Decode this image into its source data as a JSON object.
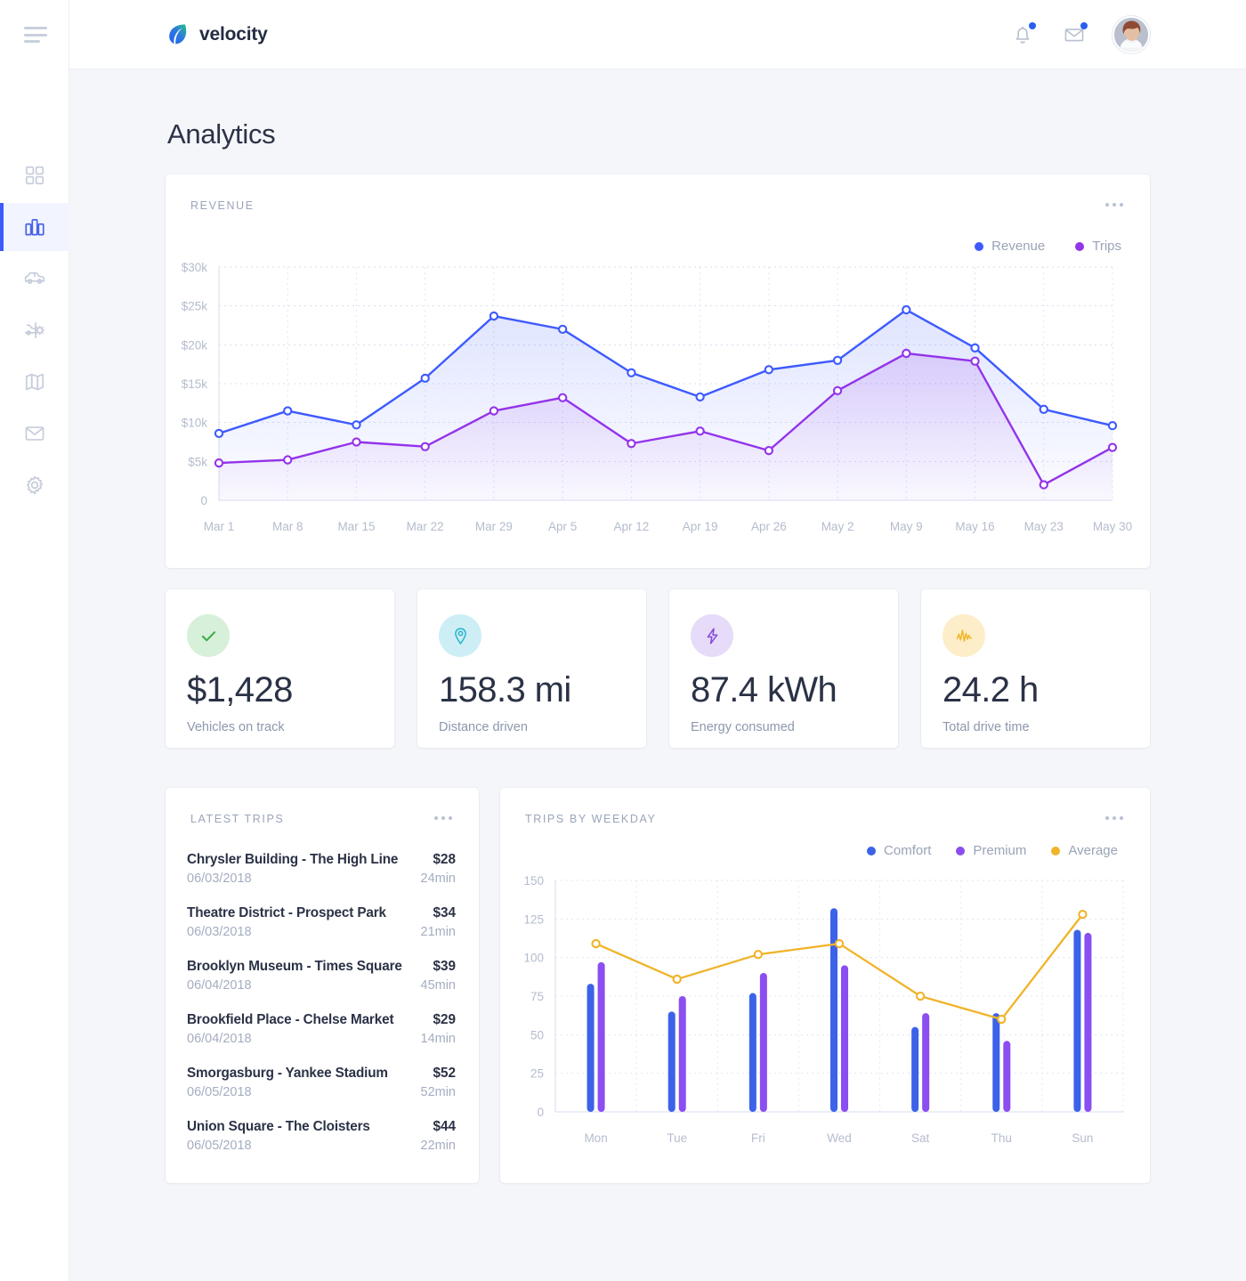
{
  "brand": {
    "name": "velocity",
    "logo_icon": "leaf-logo-icon"
  },
  "sidebar": {
    "menu_icon": "hamburger-menu-icon",
    "items": [
      {
        "name": "dashboard",
        "icon": "grid-icon",
        "active": false
      },
      {
        "name": "analytics",
        "icon": "bar-chart-icon",
        "active": true
      },
      {
        "name": "vehicles",
        "icon": "car-icon",
        "active": false
      },
      {
        "name": "maintenance",
        "icon": "car-settings-icon",
        "active": false
      },
      {
        "name": "map",
        "icon": "map-icon",
        "active": false
      },
      {
        "name": "messages",
        "icon": "mail-icon",
        "active": false
      },
      {
        "name": "settings",
        "icon": "gear-icon",
        "active": false
      }
    ]
  },
  "topbar": {
    "notifications_icon": "bell-icon",
    "messages_icon": "envelope-icon",
    "avatar": "user-avatar",
    "has_notification_badge": true,
    "has_message_badge": true
  },
  "page": {
    "title": "Analytics"
  },
  "revenue_card": {
    "label": "Revenue",
    "menu": "more-options"
  },
  "stats": [
    {
      "value": "$1,428",
      "caption": "Vehicles on track",
      "icon": "check-icon",
      "icon_bg": "#d7f0d9",
      "icon_color": "#3faa50"
    },
    {
      "value": "158.3 mi",
      "caption": "Distance driven",
      "icon": "map-pin-icon",
      "icon_bg": "#cdeef5",
      "icon_color": "#28b3cc"
    },
    {
      "value": "87.4 kWh",
      "caption": "Energy consumed",
      "icon": "lightning-bolt-icon",
      "icon_bg": "#e6dbf8",
      "icon_color": "#8249d6"
    },
    {
      "value": "24.2 h",
      "caption": "Total drive time",
      "icon": "activity-pulse-icon",
      "icon_bg": "#fdeec9",
      "icon_color": "#f1b52a"
    }
  ],
  "trips_card": {
    "label": "Latest trips",
    "menu": "more-options",
    "items": [
      {
        "name": "Chrysler Building - The High Line",
        "price": "$28",
        "date": "06/03/2018",
        "duration": "24min"
      },
      {
        "name": "Theatre District - Prospect Park",
        "price": "$34",
        "date": "06/03/2018",
        "duration": "21min"
      },
      {
        "name": "Brooklyn Museum - Times Square",
        "price": "$39",
        "date": "06/04/2018",
        "duration": "45min"
      },
      {
        "name": "Brookfield Place - Chelse Market",
        "price": "$29",
        "date": "06/04/2018",
        "duration": "14min"
      },
      {
        "name": "Smorgasburg - Yankee Stadium",
        "price": "$52",
        "date": "06/05/2018",
        "duration": "52min"
      },
      {
        "name": "Union Square - The Cloisters",
        "price": "$44",
        "date": "06/05/2018",
        "duration": "22min"
      }
    ]
  },
  "weekday_card": {
    "label": "Trips by weekday",
    "menu": "more-options"
  },
  "colors": {
    "blue": "#3d5afe",
    "purple": "#9333ea",
    "yellow": "#f0b429",
    "bar_blue": "#3b62e8",
    "bar_purple": "#8b4ef0",
    "text_dark": "#2b3246",
    "text_muted": "#9aa5bb",
    "bg": "#f4f6fa"
  },
  "chart_data": [
    {
      "type": "area",
      "title": "Revenue",
      "xlabel": "",
      "ylabel": "",
      "ylim": [
        0,
        30000
      ],
      "yticks": [
        0,
        5000,
        10000,
        15000,
        20000,
        25000,
        30000
      ],
      "ytick_labels": [
        "0",
        "$5k",
        "$10k",
        "$15k",
        "$20k",
        "$25k",
        "$30k"
      ],
      "grid": true,
      "legend_position": "top-right",
      "categories": [
        "Mar 1",
        "Mar 8",
        "Mar 15",
        "Mar 22",
        "Mar 29",
        "Apr 5",
        "Apr 12",
        "Apr 19",
        "Apr 26",
        "May 2",
        "May 9",
        "May 16",
        "May 23",
        "May 30"
      ],
      "series": [
        {
          "name": "Revenue",
          "color": "#3d5afe",
          "values": [
            8600,
            11500,
            9700,
            15700,
            23700,
            22000,
            16400,
            13300,
            16800,
            18000,
            24500,
            19600,
            11700,
            9600
          ]
        },
        {
          "name": "Trips",
          "color": "#9333ea",
          "values": [
            4800,
            5200,
            7500,
            6900,
            11500,
            13200,
            7300,
            8900,
            6400,
            14100,
            18900,
            17900,
            2000,
            6800
          ]
        }
      ],
      "note": "14 x positions; series values listed per x from Mar 1 through May 30 using nearest-tick estimates"
    },
    {
      "type": "bar",
      "title": "Trips by weekday",
      "xlabel": "",
      "ylabel": "",
      "ylim": [
        0,
        150
      ],
      "yticks": [
        0,
        25,
        50,
        75,
        100,
        125,
        150
      ],
      "ytick_labels": [
        "0",
        "25",
        "50",
        "75",
        "100",
        "125",
        "150"
      ],
      "grid": true,
      "legend_position": "top-right",
      "categories": [
        "Mon",
        "Tue",
        "Fri",
        "Wed",
        "Sat",
        "Thu",
        "Sun"
      ],
      "series": [
        {
          "name": "Comfort",
          "type": "bar",
          "color": "#3b62e8",
          "values": [
            83,
            65,
            77,
            132,
            55,
            64,
            118
          ]
        },
        {
          "name": "Premium",
          "type": "bar",
          "color": "#8b4ef0",
          "values": [
            97,
            75,
            90,
            95,
            64,
            46,
            116
          ]
        },
        {
          "name": "Average",
          "type": "line",
          "color": "#f0b429",
          "values": [
            109,
            86,
            102,
            109,
            75,
            60,
            128
          ]
        }
      ]
    }
  ]
}
